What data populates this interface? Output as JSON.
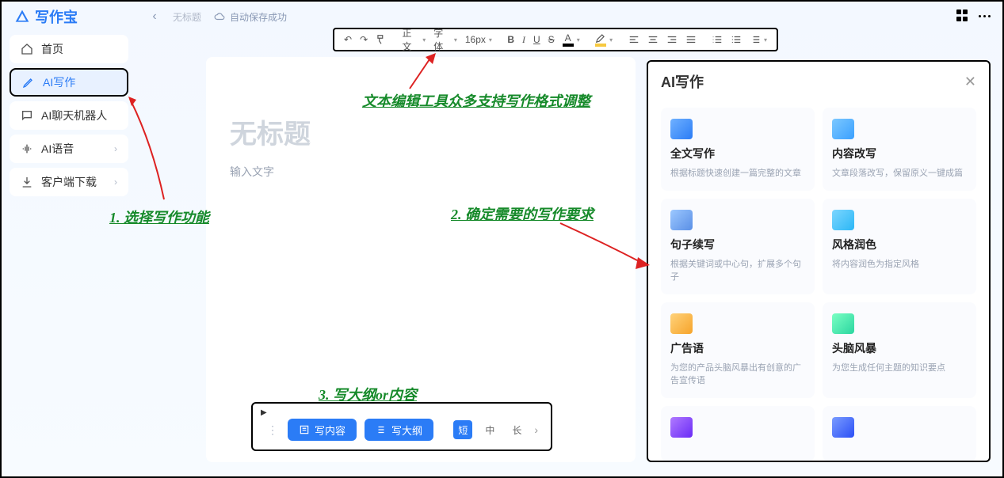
{
  "app": {
    "name": "写作宝",
    "back_doc": "无标题",
    "autosave": "自动保存成功"
  },
  "sidebar": {
    "items": [
      {
        "label": "首页",
        "has_chevron": false
      },
      {
        "label": "AI写作",
        "has_chevron": false,
        "active": true
      },
      {
        "label": "AI聊天机器人",
        "has_chevron": false
      },
      {
        "label": "AI语音",
        "has_chevron": true
      },
      {
        "label": "客户端下载",
        "has_chevron": true
      }
    ]
  },
  "toolbar": {
    "para_label": "正文",
    "font_label": "字体",
    "size_label": "16px"
  },
  "editor": {
    "title_placeholder": "无标题",
    "body_placeholder": "输入文字"
  },
  "bottombar": {
    "write_content": "写内容",
    "write_outline": "写大纲",
    "lengths": [
      "短",
      "中",
      "长"
    ],
    "active_length_index": 0
  },
  "ai_panel": {
    "title": "AI写作",
    "cards": [
      {
        "title": "全文写作",
        "desc": "根据标题快速创建一篇完整的文章"
      },
      {
        "title": "内容改写",
        "desc": "文章段落改写，保留原义一键成篇"
      },
      {
        "title": "句子续写",
        "desc": "根据关键词或中心句，扩展多个句子"
      },
      {
        "title": "风格润色",
        "desc": "将内容润色为指定风格"
      },
      {
        "title": "广告语",
        "desc": "为您的产品头脑风暴出有创意的广告宣传语"
      },
      {
        "title": "头脑风暴",
        "desc": "为您生成任何主题的知识要点"
      },
      {
        "title": "",
        "desc": ""
      },
      {
        "title": "",
        "desc": ""
      }
    ]
  },
  "annotations": {
    "a1": "1. 选择写作功能",
    "a2": "文本编辑工具众多支持写作格式调整",
    "a3": "2. 确定需要的写作要求",
    "a4": "3. 写大纲or内容"
  }
}
